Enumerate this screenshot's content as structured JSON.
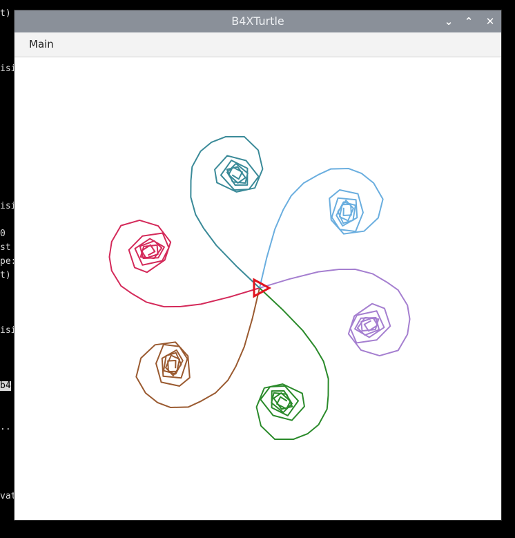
{
  "background_terminal": {
    "lines": [
      "t)",
      "isi",
      "isi",
      "0",
      "st",
      "pe:",
      "t)",
      "isi",
      "b4",
      "..",
      "vat"
    ],
    "highlighted_line": "b4"
  },
  "window": {
    "title": "B4XTurtle",
    "controls": {
      "minimize_glyph": "⌄",
      "maximize_glyph": "⌃",
      "close_glyph": "✕"
    }
  },
  "menu": {
    "items": [
      {
        "label": "Main"
      }
    ]
  },
  "canvas": {
    "background": "#ffffff",
    "turtle": {
      "color": "#e0141e",
      "heading_deg": 0
    },
    "arms": [
      {
        "name": "sky-blue",
        "color": "#6aaedf",
        "rotation_deg": -78
      },
      {
        "name": "purple",
        "color": "#a57fd0",
        "rotation_deg": -18
      },
      {
        "name": "green",
        "color": "#2a8a2a",
        "rotation_deg": 42
      },
      {
        "name": "brown",
        "color": "#9a5a30",
        "rotation_deg": 102
      },
      {
        "name": "crimson",
        "color": "#d42a5a",
        "rotation_deg": 162
      },
      {
        "name": "teal",
        "color": "#3a8a98",
        "rotation_deg": -138
      }
    ]
  }
}
